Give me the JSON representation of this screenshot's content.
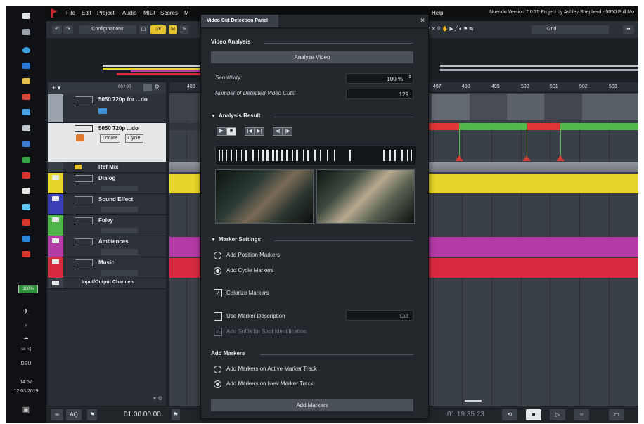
{
  "menubar": {
    "items": [
      "File",
      "Edit",
      "Project",
      "Audio",
      "MIDI",
      "Scores",
      "M"
    ],
    "help": "Help",
    "window_title": "Nuendo Version 7.0.35 Project by Ashley Shepherd - 5050 Full Mo"
  },
  "toolbar": {
    "configurations_label": "Configurations",
    "m_label": "M",
    "s_label": "S",
    "grid_label": "Grid"
  },
  "taskbar": {
    "battery": "100%",
    "language": "DEU",
    "time": "14:57",
    "date": "12.03.2019"
  },
  "tracklist": {
    "counter": "00 / 00",
    "video_track_name": "5050 720p for ...do",
    "marker_track_name": "5050 720p ...do",
    "locate_label": "Locate",
    "cycle_label": "Cycle",
    "tracks": [
      {
        "name": "Ref Mix",
        "color": "#2a2f35"
      },
      {
        "name": "Dialog",
        "color": "#e6d52a"
      },
      {
        "name": "Sound Effect",
        "color": "#3a3fb5"
      },
      {
        "name": "Foley",
        "color": "#4fb548"
      },
      {
        "name": "Ambiences",
        "color": "#b43aa6"
      },
      {
        "name": "Music",
        "color": "#d82a3e"
      },
      {
        "name": "Input/Output Channels",
        "color": "#2a2f35"
      }
    ]
  },
  "ruler": {
    "left_labels": [
      "489"
    ],
    "right_labels": [
      "497",
      "498",
      "499",
      "500",
      "501",
      "502",
      "503"
    ]
  },
  "panel": {
    "tab_title": "Video Cut Detection Panel",
    "close_glyph": "×",
    "video_analysis_title": "Video Analysis",
    "analyze_button": "Analyze Video",
    "sensitivity_label": "Sensitivity:",
    "sensitivity_value": "100 %",
    "detected_cuts_label": "Number of Detected Video Cuts:",
    "detected_cuts_value": "129",
    "analysis_result_title": "Analysis Result",
    "marker_settings_title": "Marker Settings",
    "add_position_markers": "Add Position Markers",
    "add_cycle_markers": "Add Cycle Markers",
    "colorize_markers": "Colorize Markers",
    "use_marker_description": "Use Marker Description",
    "marker_description_value": "Cut",
    "add_suffix": "Add Suffix for Shot Identification",
    "add_markers_title": "Add Markers",
    "add_on_active": "Add Markers on Active Marker Track",
    "add_on_new": "Add Markers on New Marker Track",
    "add_markers_button": "Add Markers",
    "marker_type_selected": "cycle",
    "track_target_selected": "new",
    "colorize_checked": true,
    "use_description_checked": false,
    "add_suffix_checked": true
  },
  "transport": {
    "aq_label": "AQ",
    "time_left": "01.00.00.00",
    "time_right": "01.19.35.23"
  },
  "colors": {
    "marker_track_red": "#e03535",
    "marker_track_green": "#52b847",
    "dialog": "#e6d52a",
    "ambiences": "#b43aa6",
    "music": "#d82a3e"
  }
}
